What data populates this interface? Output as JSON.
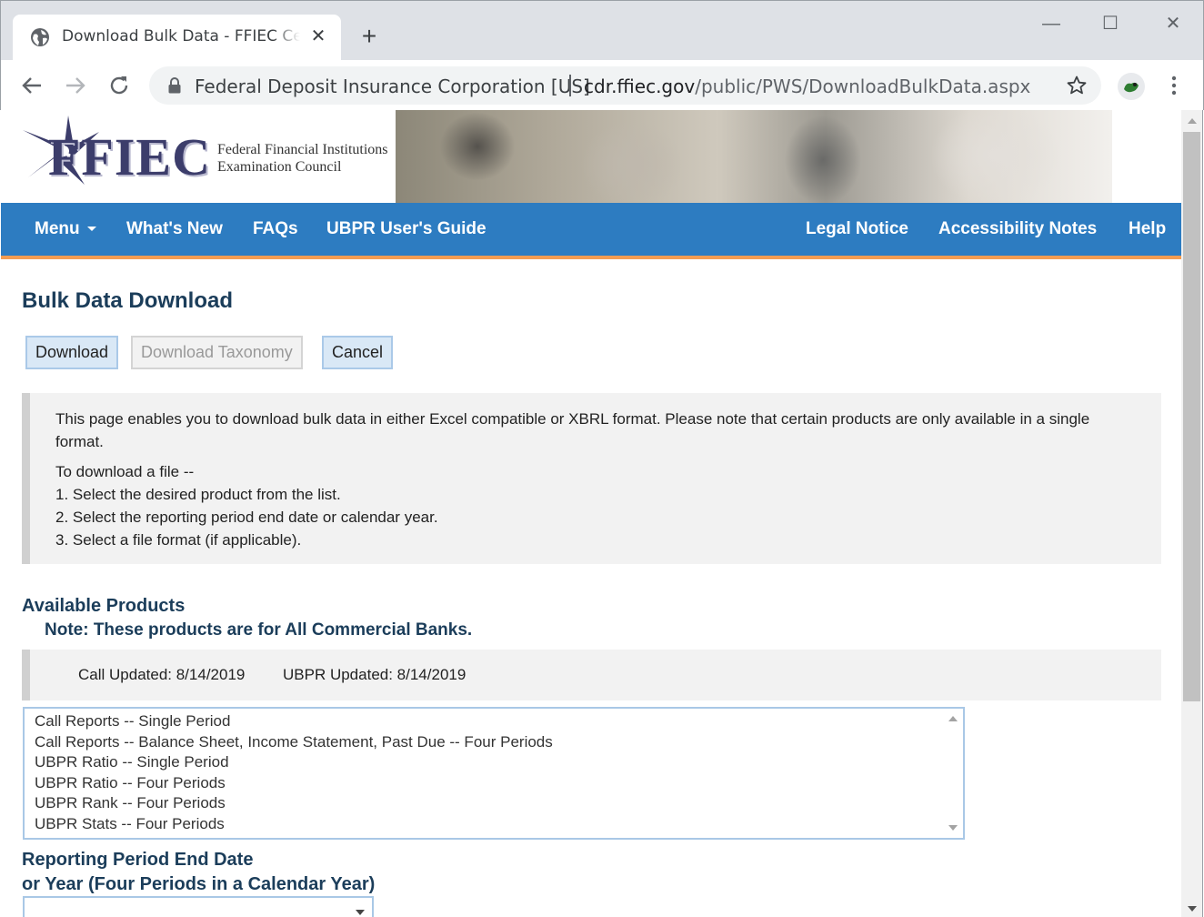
{
  "browser": {
    "tab_title": "Download Bulk Data - FFIEC Central Data Repository's Public Data Distribution",
    "tab_close_glyph": "✕",
    "new_tab_glyph": "+",
    "window_controls": {
      "minimize": "—",
      "maximize": "☐",
      "close": "✕"
    },
    "cert_owner": "Federal Deposit Insurance Corporation [US]",
    "url_host": "cdr.ffiec.gov",
    "url_path": "/public/PWS/DownloadBulkData.aspx",
    "icons": [
      "globe-icon",
      "back-arrow-icon",
      "forward-arrow-icon",
      "reload-icon",
      "lock-icon",
      "star-icon",
      "extension-icon",
      "menu-dots-icon"
    ]
  },
  "header": {
    "logo_word": "FFIEC",
    "logo_line1": "Federal Financial Institutions",
    "logo_line2": "Examination Council"
  },
  "nav": {
    "left": [
      {
        "label": "Menu",
        "has_caret": true
      },
      {
        "label": "What's New"
      },
      {
        "label": "FAQs"
      },
      {
        "label": "UBPR User's Guide"
      }
    ],
    "right": [
      {
        "label": "Legal Notice"
      },
      {
        "label": "Accessibility Notes"
      },
      {
        "label": "Help"
      }
    ],
    "colors": {
      "bar": "#2d7cc1",
      "accent": "#f39c52"
    }
  },
  "main": {
    "title": "Bulk Data Download",
    "buttons": {
      "download": "Download",
      "download_taxonomy": "Download Taxonomy",
      "cancel": "Cancel"
    },
    "info": {
      "intro": "This page enables you to download bulk data in either Excel compatible or XBRL format. Please note that certain products are only available in a single format.",
      "heading": "To download a file --",
      "steps": [
        "1. Select the desired product from the list.",
        "2. Select the reporting period end date or calendar year.",
        "3. Select a file format (if applicable)."
      ]
    },
    "available_products_label": "Available Products",
    "note": "Note: These products are for All Commercial Banks.",
    "call_updated": "Call Updated: 8/14/2019",
    "ubpr_updated": "UBPR Updated: 8/14/2019",
    "products": [
      "Call Reports -- Single Period",
      "Call Reports -- Balance Sheet, Income Statement, Past Due -- Four Periods",
      "UBPR Ratio -- Single Period",
      "UBPR Ratio -- Four Periods",
      "UBPR Rank -- Four Periods",
      "UBPR Stats -- Four Periods"
    ],
    "period_label_1": "Reporting Period End Date",
    "period_label_2": "or Year (Four Periods in a Calendar Year)",
    "period_value": ""
  }
}
